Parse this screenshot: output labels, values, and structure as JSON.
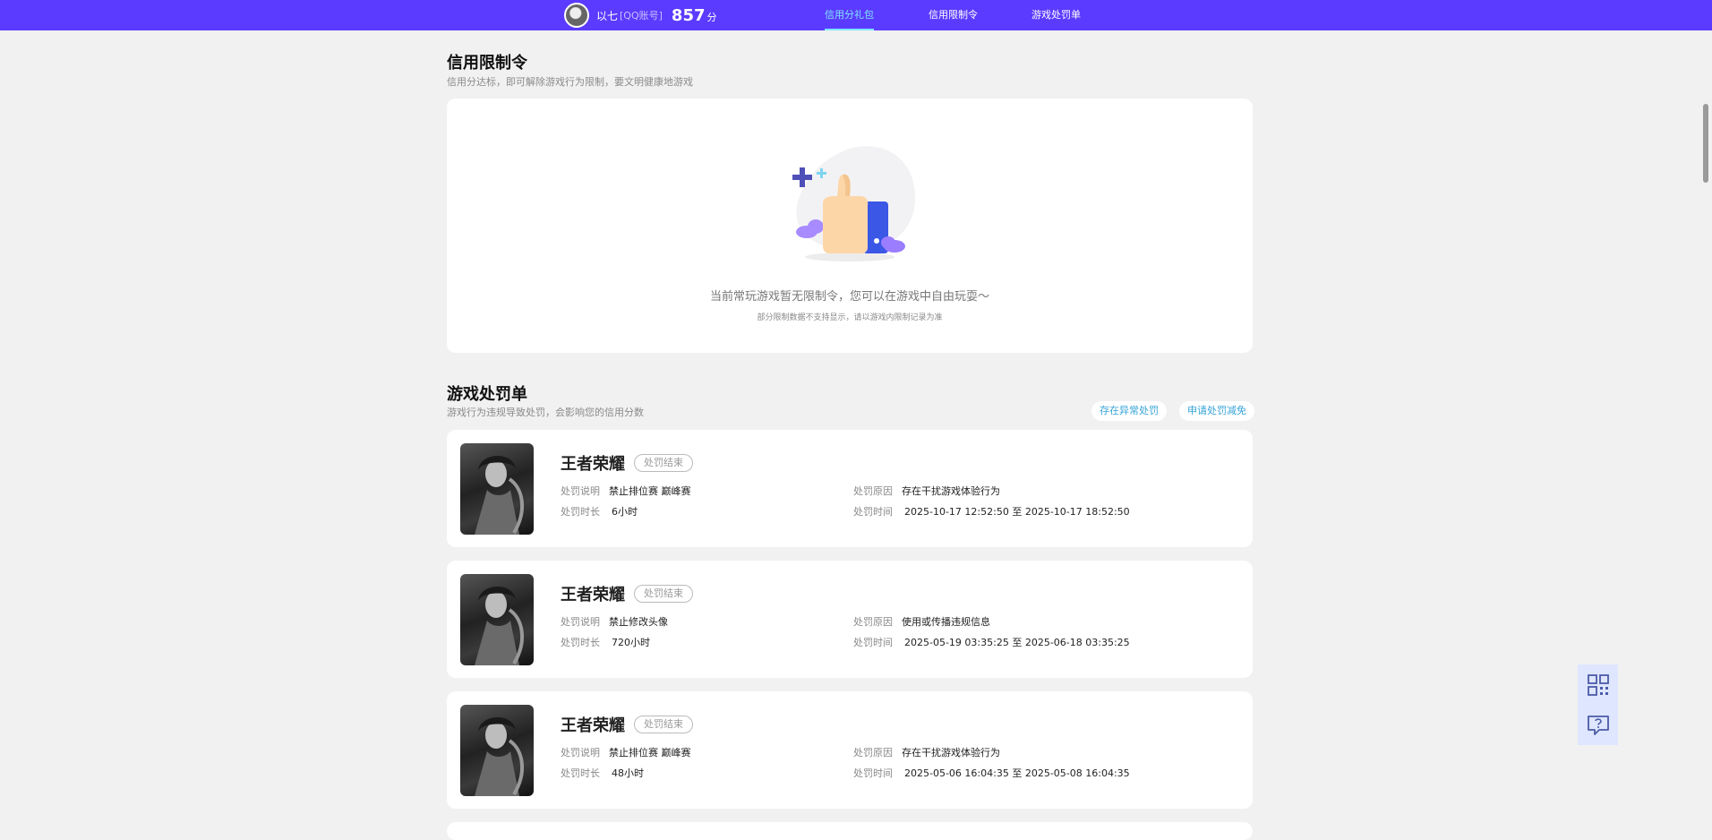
{
  "header": {
    "username": "以七",
    "account_type": "[QQ账号]",
    "score": "857",
    "score_unit": "分",
    "nav": [
      {
        "label": "信用分礼包",
        "active": true
      },
      {
        "label": "信用限制令",
        "active": false
      },
      {
        "label": "游戏处罚单",
        "active": false
      }
    ]
  },
  "restriction": {
    "title": "信用限制令",
    "subtitle": "信用分达标，即可解除游戏行为限制，要文明健康地游戏",
    "empty_text": "当前常玩游戏暂无限制令，您可以在游戏中自由玩耍～",
    "empty_hint": "部分限制数据不支持显示，请以游戏内限制记录为准"
  },
  "penalties": {
    "title": "游戏处罚单",
    "subtitle": "游戏行为违规导致处罚，会影响您的信用分数",
    "btn_abnormal": "存在异常处罚",
    "btn_reduce": "申请处罚减免",
    "labels": {
      "desc": "处罚说明",
      "duration": "处罚时长",
      "reason": "处罚原因",
      "time": "处罚时间"
    },
    "items": [
      {
        "game": "王者荣耀",
        "status": "处罚结束",
        "desc": "禁止排位赛 巅峰赛",
        "duration": "6小时",
        "reason": "存在干扰游戏体验行为",
        "time": "2025-10-17 12:52:50 至 2025-10-17 18:52:50"
      },
      {
        "game": "王者荣耀",
        "status": "处罚结束",
        "desc": "禁止修改头像",
        "duration": "720小时",
        "reason": "使用或传播违规信息",
        "time": "2025-05-19 03:35:25 至 2025-06-18 03:35:25"
      },
      {
        "game": "王者荣耀",
        "status": "处罚结束",
        "desc": "禁止排位赛 巅峰赛",
        "duration": "48小时",
        "reason": "存在干扰游戏体验行为",
        "time": "2025-05-06 16:04:35 至 2025-05-08 16:04:35"
      }
    ]
  },
  "colors": {
    "header_bg": "#5b3bff",
    "nav_active": "#7fe6ff",
    "link": "#35a3d8"
  }
}
